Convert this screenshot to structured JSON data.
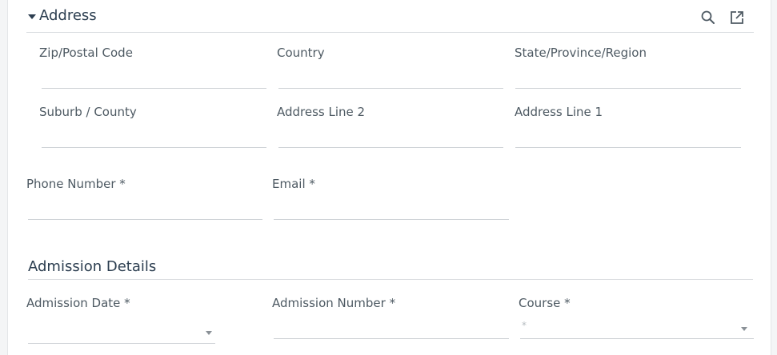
{
  "address_section": {
    "title": "Address",
    "toggle_icon": "caret-down-icon",
    "search_icon": "search-icon",
    "open_external_icon": "open-external-icon",
    "fields": {
      "zip": {
        "label": "Zip/Postal Code",
        "value": ""
      },
      "country": {
        "label": "Country",
        "value": ""
      },
      "state": {
        "label": "State/Province/Region",
        "value": ""
      },
      "suburb": {
        "label": "Suburb / County",
        "value": ""
      },
      "address_line_2": {
        "label": "Address Line 2",
        "value": ""
      },
      "address_line_1": {
        "label": "Address Line 1",
        "value": ""
      }
    }
  },
  "contact": {
    "phone": {
      "label": "Phone Number *",
      "value": ""
    },
    "email": {
      "label": "Email *",
      "value": ""
    }
  },
  "admission_section": {
    "title": "Admission Details",
    "admission_date": {
      "label": "Admission Date *",
      "value": ""
    },
    "admission_number": {
      "label": "Admission Number *",
      "value": ""
    },
    "course": {
      "label": "Course *",
      "placeholder": "*",
      "value": ""
    }
  },
  "colors": {
    "heading": "#2c3e50",
    "label": "#4e5a63",
    "rule": "#dadde0"
  }
}
